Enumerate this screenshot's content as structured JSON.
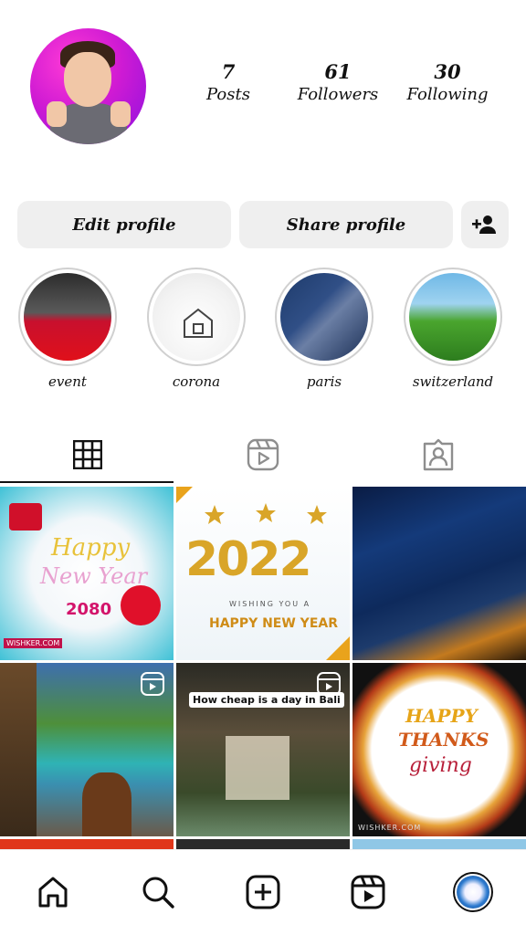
{
  "profile": {
    "stats": [
      {
        "value": "7",
        "label": "Posts"
      },
      {
        "value": "61",
        "label": "Followers"
      },
      {
        "value": "30",
        "label": "Following"
      }
    ]
  },
  "actions": {
    "edit": "Edit profile",
    "share": "Share profile"
  },
  "highlights": [
    {
      "label": "event"
    },
    {
      "label": "corona"
    },
    {
      "label": "paris"
    },
    {
      "label": "switzerland"
    }
  ],
  "posts": {
    "p1": {
      "title_1": "Happy",
      "title_2": "New Year",
      "year": "2080",
      "footer": "WISHKER.COM"
    },
    "p2": {
      "year": "2022",
      "subtitle": "WISHING YOU A",
      "title": "HAPPY NEW YEAR"
    },
    "p5": {
      "caption": "How cheap is a day in Bali"
    },
    "p6": {
      "title_1": "HAPPY",
      "title_2": "THANKS",
      "title_3": "giving",
      "footer": "WISHKER.COM"
    }
  },
  "icons": {
    "tabs": [
      "grid-icon",
      "reels-icon",
      "tagged-icon"
    ],
    "nav": [
      "home-icon",
      "search-icon",
      "create-icon",
      "reels-icon",
      "profile-avatar"
    ]
  }
}
